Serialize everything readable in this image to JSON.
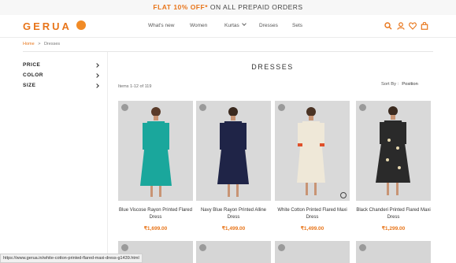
{
  "promo": {
    "highlight": "FLAT 10% OFF*",
    "rest": "ON ALL PREPAID ORDERS"
  },
  "header": {
    "logo": "GERUA",
    "nav": [
      {
        "label": "What's new"
      },
      {
        "label": "Women"
      },
      {
        "label": "Kurtas"
      },
      {
        "label": "Dresses"
      },
      {
        "label": "Sets"
      }
    ],
    "icons": [
      "search-icon",
      "user-icon",
      "wishlist-icon",
      "bag-icon"
    ]
  },
  "breadcrumb": {
    "home": "Home",
    "sep": ">",
    "current": "Dresses"
  },
  "filters": [
    "PRICE",
    "COLOR",
    "SIZE"
  ],
  "listing": {
    "title": "DRESSES",
    "count": "Items 1-12 of 119",
    "sort_label": "Sort By :",
    "sort_value": "Position"
  },
  "products": [
    {
      "name": "Blue Viscose Rayon Printed Flared Dress",
      "price": "₹1,699.00",
      "dress_color": "#1aa79c",
      "bg": "#d8d8d8"
    },
    {
      "name": "Navy Blue Rayon Printed Alline Dress",
      "price": "₹1,499.00",
      "dress_color": "#1f2447",
      "bg": "#d6d6d6"
    },
    {
      "name": "White Cotton Printed Flared Maxi Dress",
      "price": "₹1,499.00",
      "dress_color": "#efe8d8",
      "bg": "#d4d4d4"
    },
    {
      "name": "Black Chanderi Printed Flared Maxi Dress",
      "price": "₹1,299.00",
      "dress_color": "#2a2a2a",
      "bg": "#d8d8d8"
    }
  ],
  "status_url": "https://www.gerua.in/white-cotton-printed-flared-maxi-dress-g1439.html",
  "colors": {
    "accent": "#e8751a"
  }
}
